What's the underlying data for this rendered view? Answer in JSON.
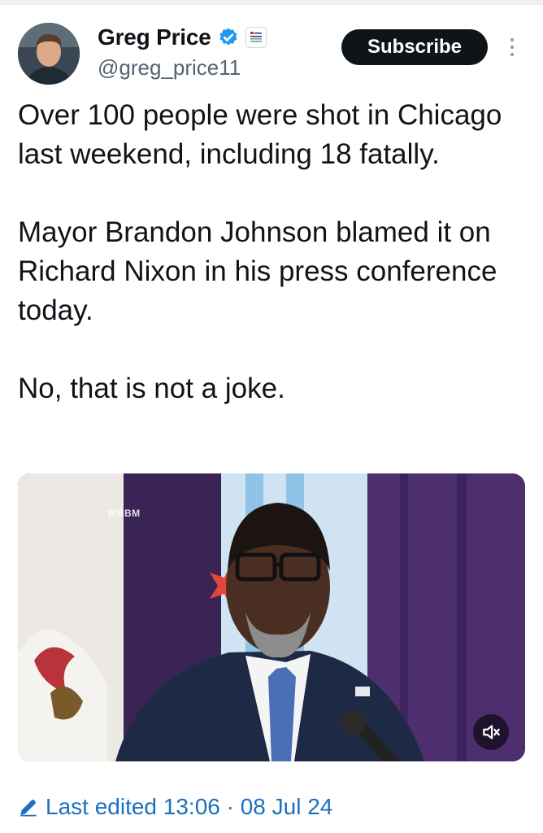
{
  "author": {
    "name": "Greg Price",
    "handle": "@greg_price11",
    "verified": true,
    "avatar_icon": "person-avatar",
    "affiliate_badge_icon": "affiliate-badge-icon"
  },
  "actions": {
    "subscribe_label": "Subscribe",
    "more_icon": "more-vertical-icon"
  },
  "tweet": {
    "paragraphs": [
      "Over 100 people were shot in Chicago last weekend, including 18 fatally.",
      "Mayor Brandon Johnson blamed it on Richard Nixon in his press conference today.",
      "No, that is not a joke."
    ]
  },
  "media": {
    "watermark": "WBBM",
    "mute_icon": "speaker-muted-icon"
  },
  "footer": {
    "edited_label": "Last edited 13:06 · 08 Jul 24",
    "edit_icon": "pencil-icon"
  },
  "colors": {
    "text": "#0f1419",
    "secondary": "#536471",
    "link": "#1d6fbf",
    "verified": "#1d9bf0",
    "button_bg": "#0f1419"
  }
}
